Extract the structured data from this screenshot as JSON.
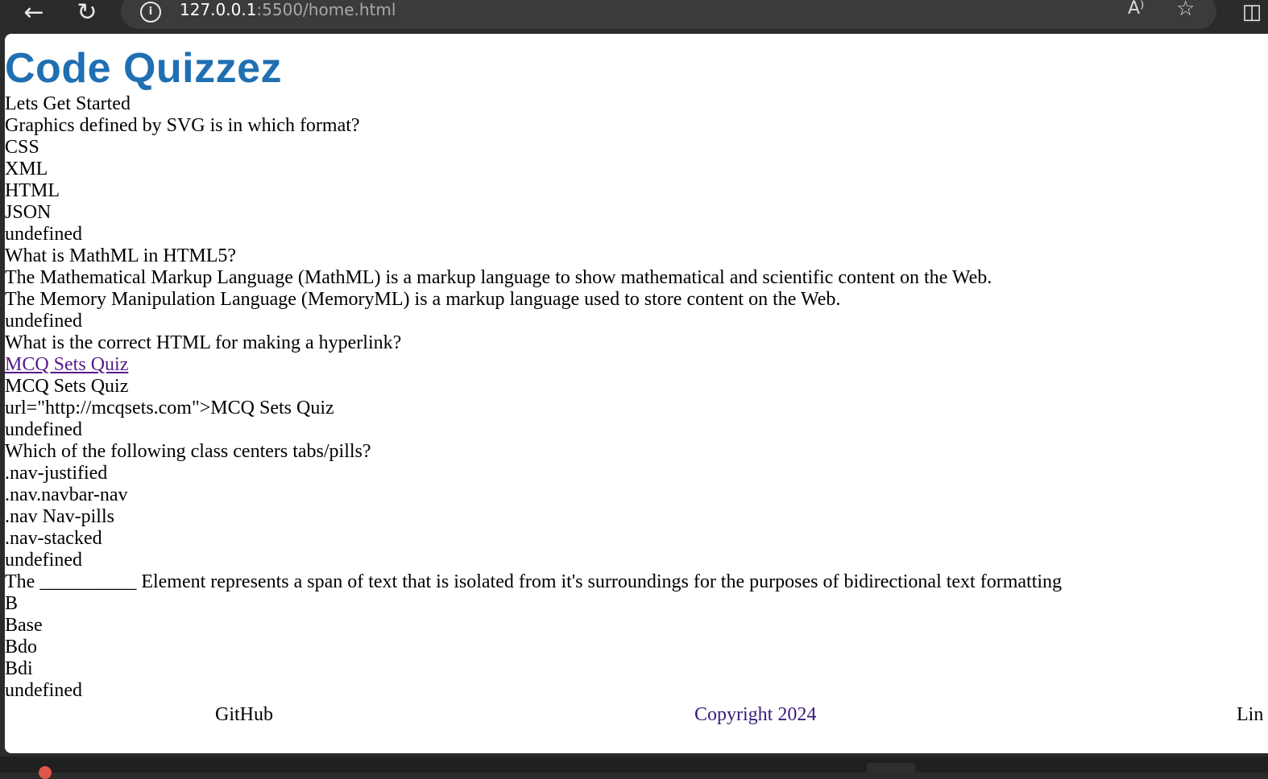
{
  "browser": {
    "back_icon": "←",
    "reload_icon": "↻",
    "info_icon": "i",
    "url_host": "127.0.0.1",
    "url_rest": ":5500/home.html",
    "read_aloud_icon": "A⁾",
    "favorite_icon": "☆",
    "split_icon": "◫"
  },
  "page": {
    "title": "Code Quizzez",
    "subtitle": "Lets Get Started",
    "questions": [
      {
        "question": "Graphics defined by SVG is in which format?",
        "options": [
          "CSS",
          "XML",
          "HTML",
          "JSON"
        ],
        "result": "undefined"
      },
      {
        "question": "What is MathML in HTML5?",
        "options": [
          "The Mathematical Markup Language (MathML) is a markup language to show mathematical and scientific content on the Web.",
          "The Memory Manipulation Language (MemoryML) is a markup language used to store content on the Web."
        ],
        "result": "undefined"
      },
      {
        "question": "What is the correct HTML for making a hyperlink?",
        "options": [
          "MCQ Sets Quiz",
          "MCQ Sets Quiz",
          "url=\"http://mcqsets.com\">MCQ Sets Quiz"
        ],
        "result": "undefined"
      },
      {
        "question": "Which of the following class centers tabs/pills?",
        "options": [
          ".nav-justified",
          ".nav.navbar-nav",
          ".nav Nav-pills",
          ".nav-stacked"
        ],
        "result": "undefined"
      },
      {
        "question": "The __________ Element represents a span of text that is isolated from it's surroundings for the purposes of bidirectional text formatting",
        "options": [
          "B",
          "Base",
          "Bdo",
          "Bdi"
        ],
        "result": "undefined"
      }
    ],
    "footer": {
      "github": "GitHub",
      "copyright": "Copyright 2024",
      "linkedin_partial": "Lin"
    }
  }
}
